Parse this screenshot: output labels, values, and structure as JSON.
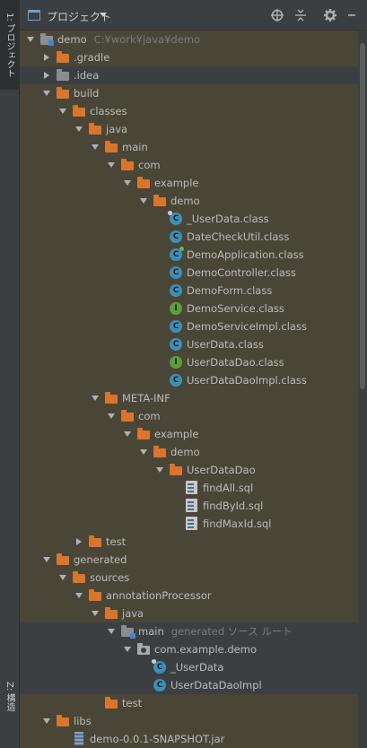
{
  "side_strip": {
    "project_label": "1: プロジェクト",
    "structure_label": "Z: 構造"
  },
  "toolbar": {
    "title": "プロジェクト",
    "buttons": [
      "crosshair-icon",
      "collapse-icon",
      "gear-icon",
      "minimize-icon"
    ]
  },
  "tree": [
    {
      "depth": 0,
      "arrow": "down",
      "icon": "module",
      "label": "demo",
      "hint": "C:¥work¥java¥demo",
      "hl": true
    },
    {
      "depth": 1,
      "arrow": "right",
      "icon": "folder",
      "label": ".gradle",
      "hl": true
    },
    {
      "depth": 1,
      "arrow": "right",
      "icon": "grey",
      "label": ".idea",
      "hl": false
    },
    {
      "depth": 1,
      "arrow": "down",
      "icon": "folder",
      "label": "build",
      "hl": true
    },
    {
      "depth": 2,
      "arrow": "down",
      "icon": "folder",
      "label": "classes",
      "hl": true
    },
    {
      "depth": 3,
      "arrow": "down",
      "icon": "folder",
      "label": "java",
      "hl": true
    },
    {
      "depth": 4,
      "arrow": "down",
      "icon": "folder",
      "label": "main",
      "hl": true
    },
    {
      "depth": 5,
      "arrow": "down",
      "icon": "folder",
      "label": "com",
      "hl": true
    },
    {
      "depth": 6,
      "arrow": "down",
      "icon": "folder",
      "label": "example",
      "hl": true
    },
    {
      "depth": 7,
      "arrow": "down",
      "icon": "folder",
      "label": "demo",
      "hl": true
    },
    {
      "depth": 8,
      "arrow": "none",
      "icon": "class-ann",
      "label": "_UserData.class",
      "hl": true
    },
    {
      "depth": 8,
      "arrow": "none",
      "icon": "class",
      "label": "DateCheckUtil.class",
      "hl": true
    },
    {
      "depth": 8,
      "arrow": "none",
      "icon": "class-app",
      "label": "DemoApplication.class",
      "hl": true
    },
    {
      "depth": 8,
      "arrow": "none",
      "icon": "class",
      "label": "DemoController.class",
      "hl": true
    },
    {
      "depth": 8,
      "arrow": "none",
      "icon": "class",
      "label": "DemoForm.class",
      "hl": true
    },
    {
      "depth": 8,
      "arrow": "none",
      "icon": "iface",
      "label": "DemoService.class",
      "hl": true
    },
    {
      "depth": 8,
      "arrow": "none",
      "icon": "class",
      "label": "DemoServiceImpl.class",
      "hl": true
    },
    {
      "depth": 8,
      "arrow": "none",
      "icon": "class",
      "label": "UserData.class",
      "hl": true
    },
    {
      "depth": 8,
      "arrow": "none",
      "icon": "iface",
      "label": "UserDataDao.class",
      "hl": true
    },
    {
      "depth": 8,
      "arrow": "none",
      "icon": "class",
      "label": "UserDataDaoImpl.class",
      "hl": true
    },
    {
      "depth": 4,
      "arrow": "down",
      "icon": "folder",
      "label": "META-INF",
      "hl": true
    },
    {
      "depth": 5,
      "arrow": "down",
      "icon": "folder",
      "label": "com",
      "hl": true
    },
    {
      "depth": 6,
      "arrow": "down",
      "icon": "folder",
      "label": "example",
      "hl": true
    },
    {
      "depth": 7,
      "arrow": "down",
      "icon": "folder",
      "label": "demo",
      "hl": true
    },
    {
      "depth": 8,
      "arrow": "down",
      "icon": "folder",
      "label": "UserDataDao",
      "hl": true
    },
    {
      "depth": 9,
      "arrow": "none",
      "icon": "sql",
      "label": "findAll.sql",
      "hl": true
    },
    {
      "depth": 9,
      "arrow": "none",
      "icon": "sql",
      "label": "findById.sql",
      "hl": true
    },
    {
      "depth": 9,
      "arrow": "none",
      "icon": "sql",
      "label": "findMaxId.sql",
      "hl": true
    },
    {
      "depth": 3,
      "arrow": "right",
      "icon": "folder",
      "label": "test",
      "hl": true
    },
    {
      "depth": 1,
      "arrow": "down",
      "icon": "folder",
      "label": "generated",
      "hl": true
    },
    {
      "depth": 2,
      "arrow": "down",
      "icon": "folder",
      "label": "sources",
      "hl": true
    },
    {
      "depth": 3,
      "arrow": "down",
      "icon": "folder",
      "label": "annotationProcessor",
      "hl": true
    },
    {
      "depth": 4,
      "arrow": "down",
      "icon": "folder",
      "label": "java",
      "hl": true
    },
    {
      "depth": 5,
      "arrow": "down",
      "icon": "src",
      "label": "main",
      "hint": "generated ソース ルート",
      "hl": false
    },
    {
      "depth": 6,
      "arrow": "down",
      "icon": "pkg",
      "label": "com.example.demo",
      "hl": false
    },
    {
      "depth": 7,
      "arrow": "none",
      "icon": "class-ann",
      "label": "_UserData",
      "hl": false
    },
    {
      "depth": 7,
      "arrow": "none",
      "icon": "class",
      "label": "UserDataDaoImpl",
      "hl": false
    },
    {
      "depth": 4,
      "arrow": "none",
      "icon": "folder",
      "label": "test",
      "hl": true
    },
    {
      "depth": 1,
      "arrow": "down",
      "icon": "folder",
      "label": "libs",
      "hl": true
    },
    {
      "depth": 2,
      "arrow": "none",
      "icon": "jar",
      "label": "demo-0.0.1-SNAPSHOT.jar",
      "hl": true
    }
  ]
}
